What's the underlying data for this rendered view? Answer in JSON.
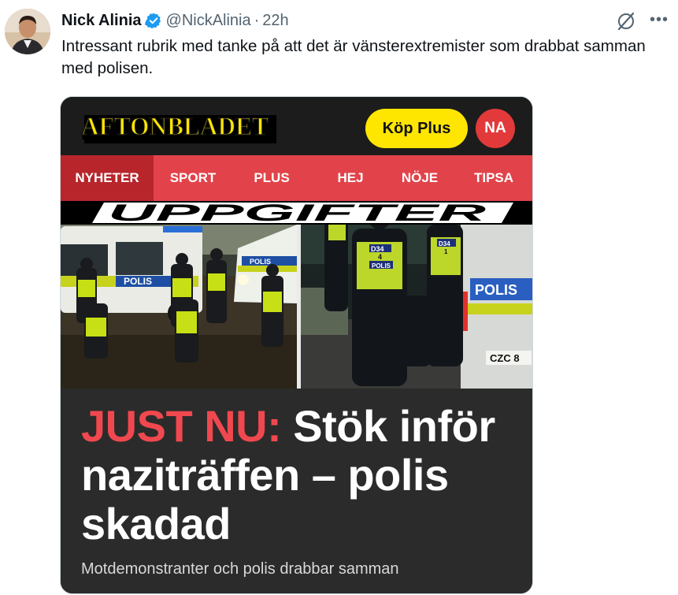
{
  "author": {
    "display_name": "Nick Alinia",
    "handle": "@NickAlinia",
    "separator": "·",
    "time": "22h"
  },
  "tweet_text": "Intressant rubrik med tanke på att det är vänsterextremister som drabbat samman med polisen.",
  "icons": {
    "verified": "verified-badge-icon",
    "grok": "grok-icon",
    "more": "more-options-icon"
  },
  "media": {
    "logo_text": "AFTONBLADET",
    "buy_button": "Köp Plus",
    "user_initials": "NA",
    "nav": [
      "NYHETER",
      "SPORT",
      "PLUS",
      "HEJ",
      "NÖJE",
      "TIPSA"
    ],
    "banner": "UPPGIFTER",
    "headline_prefix": "JUST NU:",
    "headline_rest": " Stök inför naziträffen – polis skadad",
    "subheadline": "Motdemonstranter och polis drabbar samman",
    "photo_texts": {
      "van_left": "POLIS",
      "van_left_small": "POLIS",
      "van_right": "POLIS",
      "vest_1": "D34",
      "vest_1_num": "4",
      "vest_1_word": "POLIS",
      "vest_2": "D34",
      "vest_2_num": "1",
      "plate": "CZC 8"
    }
  },
  "colors": {
    "brand_red": "#e2434a",
    "nav_active": "#b8262c",
    "buy_yellow": "#ffe600",
    "headline_red": "#f0484f",
    "verified_blue": "#1d9bf0"
  }
}
